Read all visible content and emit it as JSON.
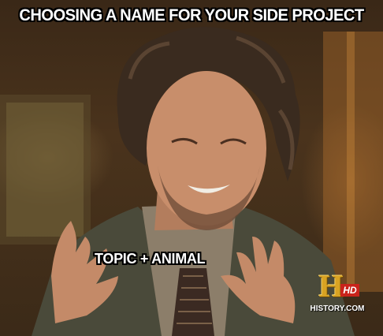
{
  "meme": {
    "top_caption": "CHOOSING A NAME FOR YOUR SIDE PROJECT",
    "middle_caption": "TOPIC + ANIMAL"
  },
  "watermark": {
    "logo_letter": "H",
    "logo_badge": "HD",
    "logo_text": "HISTORY.COM"
  }
}
